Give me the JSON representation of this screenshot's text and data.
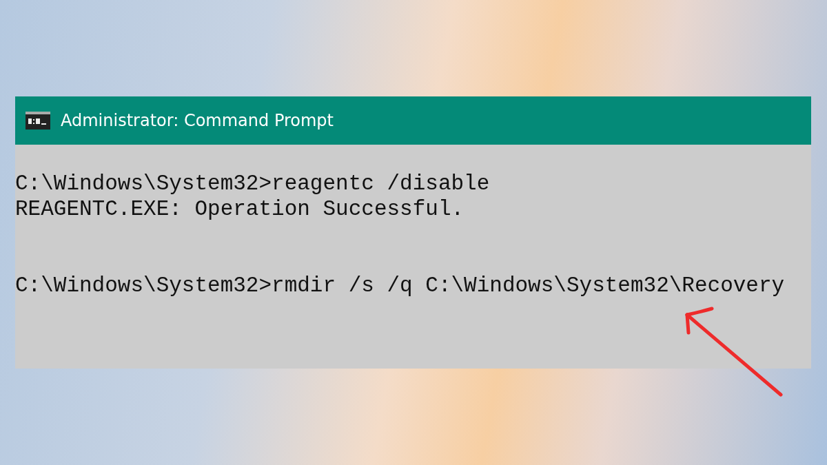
{
  "window": {
    "title": "Administrator: Command Prompt"
  },
  "console": {
    "lines": [
      {
        "kind": "text",
        "text": "C:\\Windows\\System32>reagentc /disable"
      },
      {
        "kind": "text",
        "text": "REAGENTC.EXE: Operation Successful."
      },
      {
        "kind": "blank"
      },
      {
        "kind": "blank"
      },
      {
        "kind": "text",
        "text": "C:\\Windows\\System32>rmdir /s /q C:\\Windows\\System32\\Recovery"
      }
    ]
  }
}
